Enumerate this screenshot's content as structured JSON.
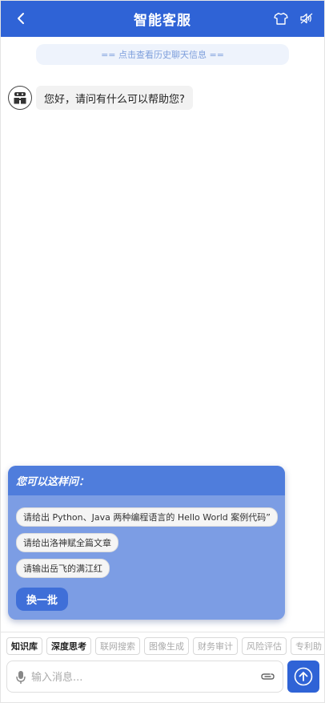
{
  "header": {
    "title": "智能客服",
    "back_icon": "chevron-left-icon",
    "shirt_icon": "shirt-icon",
    "speaker_icon": "speaker-icon"
  },
  "history_link": "== 点击查看历史聊天信息 ==",
  "messages": [
    {
      "sender": "bot",
      "text": "您好，请问有什么可以帮助您?"
    }
  ],
  "suggestions": {
    "title": "您可以这样问：",
    "items": [
      "请给出 Python、Java 两种编程语言的 Hello World 案例代码”",
      "请给出洛神赋全篇文章",
      "请输出岳飞的满江红"
    ],
    "refresh_label": "换一批"
  },
  "tools": [
    {
      "label": "知识库",
      "state": "active"
    },
    {
      "label": "深度思考",
      "state": "active"
    },
    {
      "label": "联网搜索",
      "state": "disabled"
    },
    {
      "label": "图像生成",
      "state": "disabled"
    },
    {
      "label": "财务审计",
      "state": "disabled"
    },
    {
      "label": "风险评估",
      "state": "disabled"
    },
    {
      "label": "专利助",
      "state": "disabled"
    }
  ],
  "input": {
    "placeholder": "输入消息...",
    "value": ""
  },
  "colors": {
    "primary": "#2f63d6",
    "card_bg": "#7c9de4",
    "card_header": "#4f7ddc"
  }
}
